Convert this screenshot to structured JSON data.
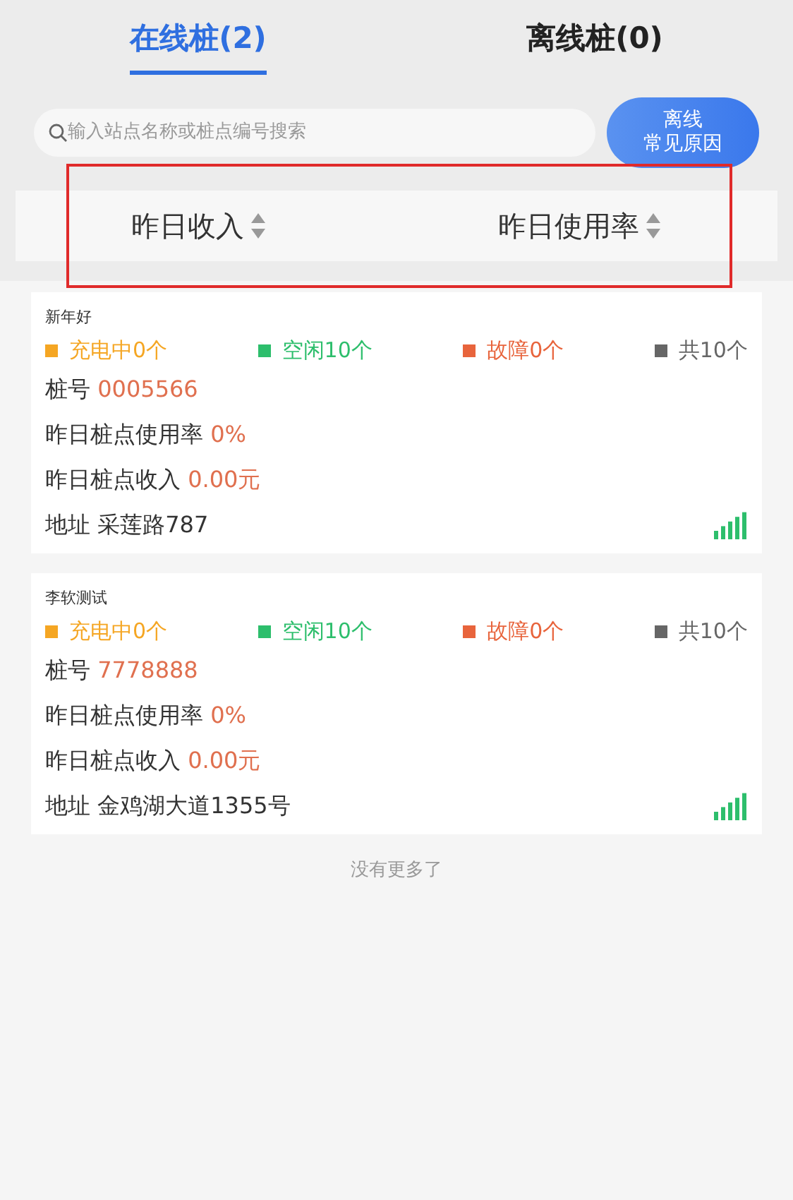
{
  "tabs": [
    {
      "label": "在线桩(2)",
      "selected": true
    },
    {
      "label": "离线桩(0)",
      "selected": false
    }
  ],
  "search": {
    "placeholder": "输入站点名称或桩点编号搜索"
  },
  "help_button": {
    "lines": [
      "离线",
      "常见原因"
    ]
  },
  "sort_bar": {
    "highlighted": true,
    "options": [
      {
        "label": "昨日收入"
      },
      {
        "label": "昨日使用率"
      }
    ]
  },
  "stations": [
    {
      "name": "新年好",
      "statuses": [
        {
          "label": "充电中0个",
          "color": "#f5a623"
        },
        {
          "label": "空闲10个",
          "color": "#2dbe6c"
        },
        {
          "label": "故障0个",
          "color": "#e8643c"
        },
        {
          "label": "共10个",
          "color": "#666666"
        }
      ],
      "fields": [
        {
          "label": "桩号",
          "value": "0005566",
          "kind": "accent"
        },
        {
          "label": "昨日桩点使用率",
          "value": "0%",
          "kind": "accent"
        },
        {
          "label": "昨日桩点收入",
          "value": "0.00元",
          "kind": "accent"
        },
        {
          "label": "地址",
          "value": "采莲路787",
          "kind": "plain"
        }
      ]
    },
    {
      "name": "李软测试",
      "statuses": [
        {
          "label": "充电中0个",
          "color": "#f5a623"
        },
        {
          "label": "空闲10个",
          "color": "#2dbe6c"
        },
        {
          "label": "故障0个",
          "color": "#e8643c"
        },
        {
          "label": "共10个",
          "color": "#666666"
        }
      ],
      "fields": [
        {
          "label": "桩号",
          "value": "7778888",
          "kind": "accent"
        },
        {
          "label": "昨日桩点使用率",
          "value": "0%",
          "kind": "accent"
        },
        {
          "label": "昨日桩点收入",
          "value": "0.00元",
          "kind": "accent"
        },
        {
          "label": "地址",
          "value": "金鸡湖大道1355号",
          "kind": "plain"
        }
      ]
    }
  ],
  "footer": "没有更多了"
}
